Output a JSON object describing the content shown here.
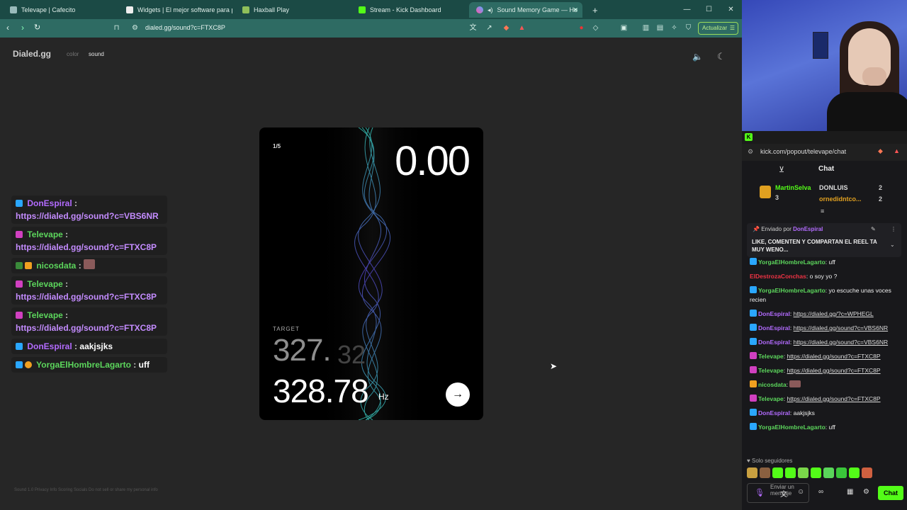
{
  "browser": {
    "tabs": [
      {
        "label": "Televape | Cafecito"
      },
      {
        "label": "Widgets | El mejor software para pot"
      },
      {
        "label": "Haxball Play"
      },
      {
        "label": "Stream - Kick Dashboard"
      },
      {
        "label": "Sound Memory Game — Ho"
      }
    ],
    "url": "dialed.gg/sound?c=FTXC8P",
    "update_label": "Actualizar",
    "colors": {
      "tabbar": "#1b4a45",
      "toolbar": "#2e6b63"
    }
  },
  "site": {
    "brand": "Dialed.gg",
    "nav": {
      "color": "color",
      "sound": "sound"
    }
  },
  "game": {
    "round": "1/5",
    "timer": "0.00",
    "target_label": "TARGET",
    "target_value": "327.",
    "target_ghost": "32",
    "current_value": "328.78",
    "unit": "Hz"
  },
  "overlay": {
    "messages": [
      {
        "user": "DonEspiral",
        "sep": " :",
        "text": "https://dialed.gg/sound?c=VBS6NR"
      },
      {
        "user": "Televape",
        "sep": " :",
        "text": "https://dialed.gg/sound?c=FTXC8P"
      },
      {
        "user": "nicosdata",
        "sep": " :",
        "text": ""
      },
      {
        "user": "Televape",
        "sep": " :",
        "text": "https://dialed.gg/sound?c=FTXC8P"
      },
      {
        "user": "Televape",
        "sep": " :",
        "text": "https://dialed.gg/sound?c=FTXC8P"
      },
      {
        "user": "DonEspiral",
        "sep": " :",
        "text": "aakjsjks"
      },
      {
        "user": "YorgaElHombreLagarto",
        "sep": " :",
        "text": "uff"
      }
    ]
  },
  "footer": "Sound 1.0   Privacy   Info   Scoring   Socials   Do not sell or share my personal info",
  "kick": {
    "url": "kick.com/popout/televape/chat",
    "chat_title": "Chat",
    "leaderboard": [
      {
        "name": "MartinSelva",
        "count": "3"
      },
      {
        "name": "DONLUIS",
        "count": "2"
      },
      {
        "name": "ornedidntco...",
        "count": "2"
      }
    ],
    "pinned_by_label": "Enviado por",
    "pinned_by_user": "DonEspiral",
    "pinned_text": "LIKE, COMENTEN Y COMPARTAN EL REEL TA MUY WENO...",
    "chat": [
      {
        "user": "YorgaElHombreLagarto",
        "text": "uff",
        "link": ""
      },
      {
        "user": "ElDestrozaConchas",
        "text": "o soy yo ?",
        "link": ""
      },
      {
        "user": "YorgaElHombreLagarto",
        "text": "yo escuche unas voces recien",
        "link": ""
      },
      {
        "user": "DonEspiral",
        "text": "",
        "link": "https://dialed.gg/?c=WPHEGL"
      },
      {
        "user": "DonEspiral",
        "text": "",
        "link": "https://dialed.gg/sound?c=VBS6NR"
      },
      {
        "user": "DonEspiral",
        "text": "",
        "link": "https://dialed.gg/sound?c=VBS6NR"
      },
      {
        "user": "Televape",
        "text": "",
        "link": "https://dialed.gg/sound?c=FTXC8P"
      },
      {
        "user": "Televape",
        "text": "",
        "link": "https://dialed.gg/sound?c=FTXC8P"
      },
      {
        "user": "nicosdata",
        "text": "",
        "link": ""
      },
      {
        "user": "Televape",
        "text": "",
        "link": "https://dialed.gg/sound?c=FTXC8P"
      },
      {
        "user": "DonEspiral",
        "text": "aakjsjks",
        "link": ""
      },
      {
        "user": "YorgaElHombreLagarto",
        "text": "uff",
        "link": ""
      }
    ],
    "followers_only": "Solo seguidores",
    "input_placeholder": "Enviar un mensaje",
    "send_label": "Chat"
  }
}
